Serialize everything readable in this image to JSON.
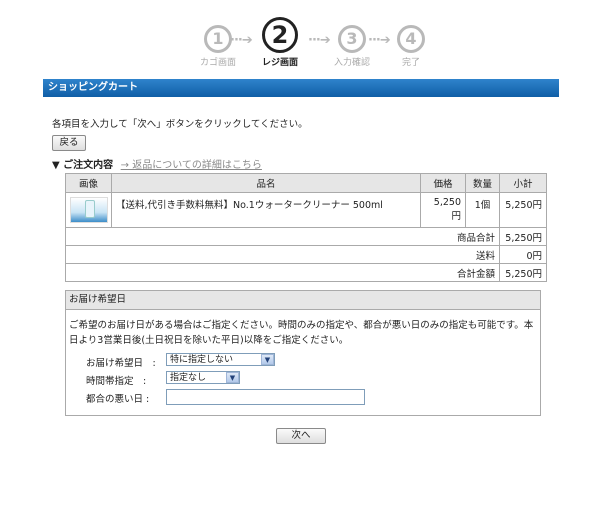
{
  "steps": [
    {
      "num": "1",
      "label": "カゴ画面"
    },
    {
      "num": "2",
      "label": "レジ画面"
    },
    {
      "num": "3",
      "label": "入力確認"
    },
    {
      "num": "4",
      "label": "完了"
    }
  ],
  "step_arrow": "···➔",
  "section_bar": "ショッピングカート",
  "instruction": "各項目を入力して「次へ」ボタンをクリックしてください。",
  "back_button": "戻る",
  "order": {
    "heading": "▼ ご注文内容",
    "return_link": "→ 返品についての詳細はこちら"
  },
  "cart": {
    "headers": {
      "image": "画像",
      "name": "品名",
      "price": "価格",
      "qty": "数量",
      "subtotal": "小計"
    },
    "item": {
      "name": "【送料,代引き手数料無料】No.1ウォータークリーナー 500ml",
      "price": "5,250円",
      "qty": "1個",
      "subtotal": "5,250円"
    },
    "summary": [
      {
        "label": "商品合計",
        "value": "5,250円"
      },
      {
        "label": "送料",
        "value": "0円"
      },
      {
        "label": "合計金額",
        "value": "5,250円"
      }
    ]
  },
  "delivery": {
    "title": "お届け希望日",
    "description": "ご希望のお届け日がある場合はご指定ください。時間のみの指定や、都合が悪い日のみの指定も可能です。本日より3営業日後(土日祝日を除いた平日)以降をご指定ください。",
    "date_label": "お届け希望日　:",
    "date_value": "特に指定しない",
    "time_label": "時間帯指定　:",
    "time_value": "指定なし",
    "bad_day_label": "都合の悪い日 :",
    "bad_day_value": ""
  },
  "next_button": "次へ"
}
